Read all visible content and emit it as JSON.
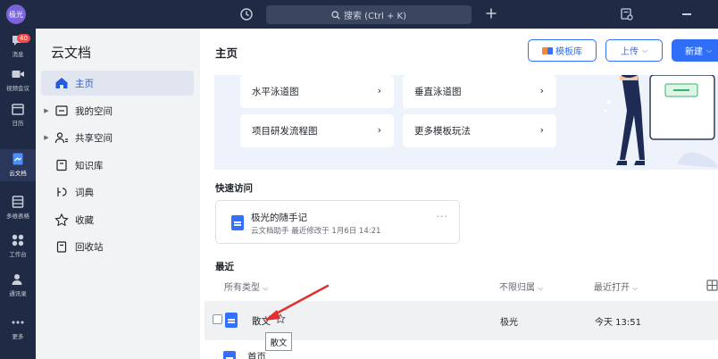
{
  "topbar": {
    "avatar_text": "极光",
    "search_placeholder": "搜索 (Ctrl + K)"
  },
  "rail": {
    "badge": "40",
    "items": [
      {
        "label": "消息"
      },
      {
        "label": "视频会议"
      },
      {
        "label": "日历"
      },
      {
        "label": "云文档"
      },
      {
        "label": "多维表格"
      },
      {
        "label": "工作台"
      },
      {
        "label": "通讯录"
      },
      {
        "label": "更多"
      }
    ]
  },
  "sidebar": {
    "title": "云文档",
    "items": [
      {
        "label": "主页"
      },
      {
        "label": "我的空间"
      },
      {
        "label": "共享空间"
      },
      {
        "label": "知识库"
      },
      {
        "label": "词典"
      },
      {
        "label": "收藏"
      },
      {
        "label": "回收站"
      }
    ]
  },
  "main": {
    "title": "主页",
    "buttons": {
      "template": "模板库",
      "upload": "上传",
      "new": "新建"
    },
    "template_cards": [
      {
        "label": "水平泳道图"
      },
      {
        "label": "垂直泳道图"
      },
      {
        "label": "项目研发流程图"
      },
      {
        "label": "更多模板玩法"
      }
    ],
    "quick_access": {
      "label": "快速访问",
      "doc_title": "极光的随手记",
      "doc_meta": "云文档助手 最近修改于 1月6日 14:21"
    },
    "recent": {
      "label": "最近",
      "col_type": "所有类型",
      "col_owner": "不限归属",
      "col_opened": "最近打开",
      "rows": [
        {
          "name": "散文",
          "owner": "极光",
          "time": "今天 13:51"
        },
        {
          "name": "首页"
        }
      ],
      "tooltip": "散文"
    }
  },
  "colors": {
    "dark_nav": "#1f2a44",
    "accent": "#2f6ef7",
    "arrow": "#e03030"
  }
}
